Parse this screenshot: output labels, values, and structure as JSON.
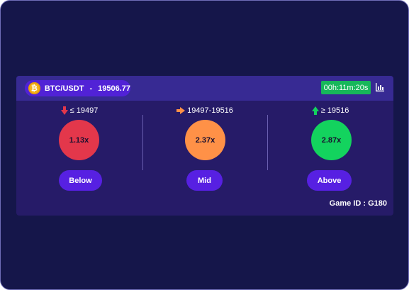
{
  "header": {
    "coin_symbol": "₿",
    "pair": "BTC/USDT",
    "separator": "-",
    "price": "19506.77",
    "timer": "00h:11m:20s",
    "stats_icon": "bar-chart-icon"
  },
  "options": [
    {
      "key": "below",
      "icon": "arrow-down-icon",
      "range": "≤ 19497",
      "multiplier": "1.13x",
      "button": "Below",
      "color": "#e3374b"
    },
    {
      "key": "mid",
      "icon": "arrow-right-icon",
      "range": "19497-19516",
      "multiplier": "2.37x",
      "button": "Mid",
      "color": "#ff9147"
    },
    {
      "key": "above",
      "icon": "arrow-up-icon",
      "range": "≥ 19516",
      "multiplier": "2.87x",
      "button": "Above",
      "color": "#13d35e"
    }
  ],
  "footer": {
    "game_id": "Game ID : G180"
  },
  "colors": {
    "background": "#15164a",
    "card": "#261b68",
    "header_bar": "#372a93",
    "accent": "#5720e2",
    "timer": "#17b75a"
  }
}
